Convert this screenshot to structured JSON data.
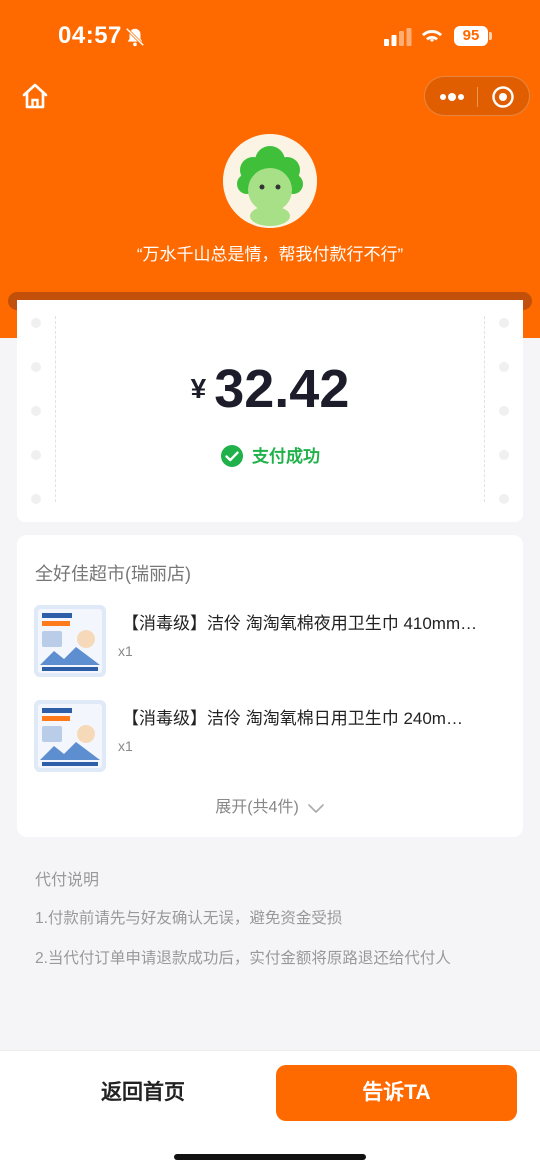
{
  "status_bar": {
    "time": "04:57",
    "battery": "95"
  },
  "header": {
    "quote": "“万水千山总是情，帮我付款行不行”"
  },
  "payment": {
    "currency": "¥",
    "amount": "32.42",
    "status": "支付成功"
  },
  "order": {
    "shop": "全好佳超市(瑞丽店)",
    "items": [
      {
        "title": "【消毒级】洁伶 淘淘氧棉夜用卫生巾 410mm…",
        "qty": "x1"
      },
      {
        "title": "【消毒级】洁伶 淘淘氧棉日用卫生巾 240m…",
        "qty": "x1"
      }
    ],
    "expand_label": "展开(共4件)"
  },
  "notes": {
    "title": "代付说明",
    "lines": [
      "1.付款前请先与好友确认无误，避免资金受损",
      "2.当代付订单申请退款成功后，实付金额将原路退还给代付人"
    ]
  },
  "actions": {
    "back_home": "返回首页",
    "tell": "告诉TA"
  },
  "colors": {
    "brand": "#ff6a00",
    "success": "#21b14a"
  }
}
